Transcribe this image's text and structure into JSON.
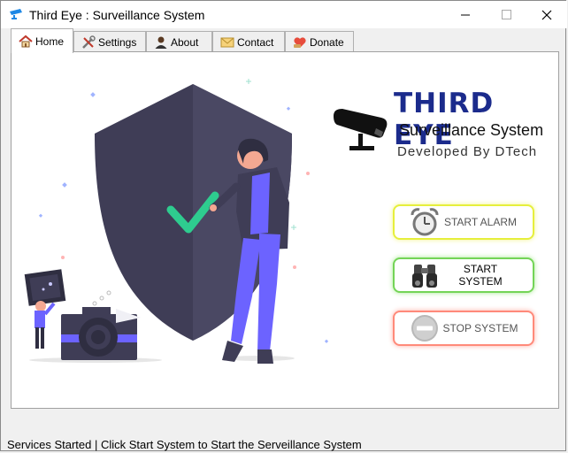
{
  "window": {
    "title": "Third Eye : Surveillance System",
    "controls": {
      "minimize": "—",
      "maximize": "☐",
      "close": "✕"
    }
  },
  "tabs": [
    {
      "label": "Home",
      "icon": "home-icon",
      "active": true
    },
    {
      "label": "Settings",
      "icon": "tools-icon",
      "active": false
    },
    {
      "label": "About",
      "icon": "user-icon",
      "active": false
    },
    {
      "label": "Contact",
      "icon": "envelope-icon",
      "active": false
    },
    {
      "label": "Donate",
      "icon": "donate-icon",
      "active": false
    }
  ],
  "logo": {
    "title": "THIRD EYE",
    "subtitle": "Surveillance System",
    "developer": "Developed By DTech"
  },
  "buttons": {
    "start_alarm": "START ALARM",
    "start_system": "START SYSTEM",
    "stop_system": "STOP SYSTEM"
  },
  "colors": {
    "shield": "#3f3d56",
    "accent": "#6c63ff",
    "check": "#2ecc8f",
    "logo_text": "#1b2b8c",
    "alarm_glow": "#e6ef3c",
    "start_glow": "#74d457",
    "stop_glow": "#ff8a7a"
  },
  "status_bar": "Services Started | Click Start System to Start the Serveillance System"
}
